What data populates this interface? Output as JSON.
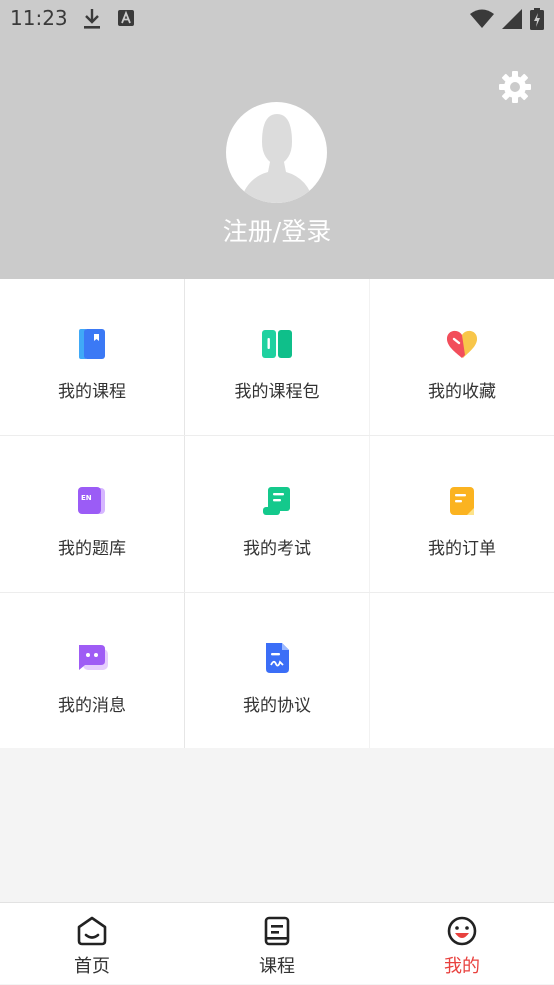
{
  "status": {
    "time": "11:23"
  },
  "profile": {
    "login_label": "注册/登录"
  },
  "menu": [
    {
      "label": "我的课程"
    },
    {
      "label": "我的课程包"
    },
    {
      "label": "我的收藏"
    },
    {
      "label": "我的题库"
    },
    {
      "label": "我的考试"
    },
    {
      "label": "我的订单"
    },
    {
      "label": "我的消息"
    },
    {
      "label": "我的协议"
    }
  ],
  "tabs": [
    {
      "label": "首页"
    },
    {
      "label": "课程"
    },
    {
      "label": "我的"
    }
  ],
  "colors": {
    "accent": "#e8413e",
    "header_bg": "#cbcbcb"
  }
}
